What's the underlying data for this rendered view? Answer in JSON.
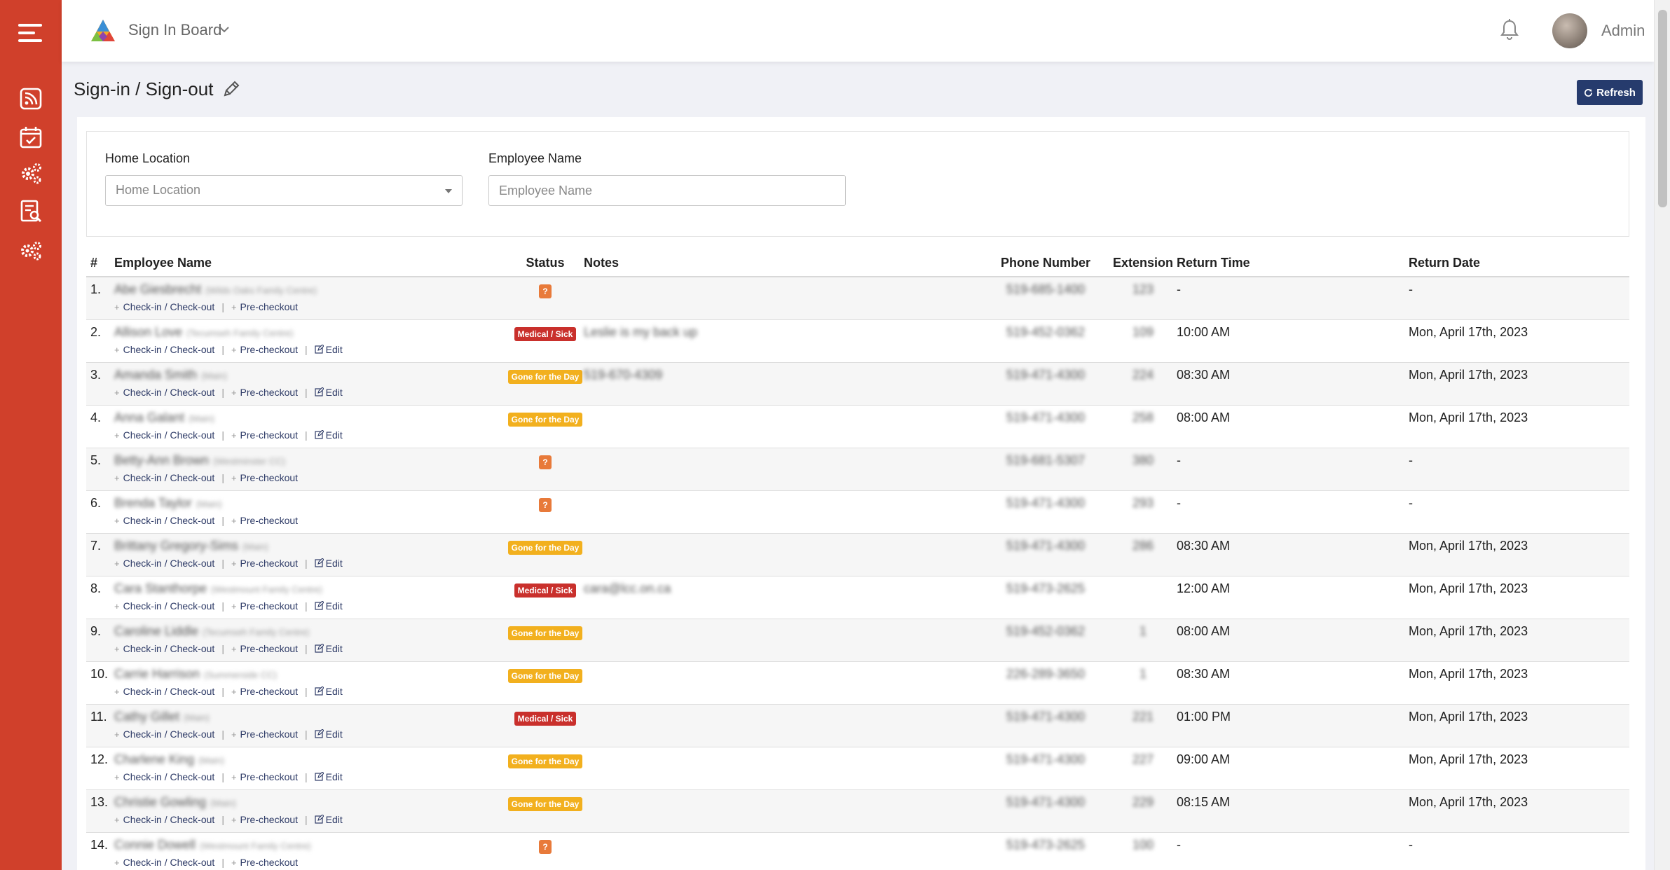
{
  "app": {
    "title": "Sign In Board",
    "user": "Admin",
    "colors": {
      "sidebar": "#d0402b",
      "primary": "#263b6d",
      "badge_sick": "#c9302c",
      "badge_gone": "#f2b01e",
      "badge_unknown": "#e87a3a"
    }
  },
  "sidebar": {
    "items": [
      {
        "icon": "rss-feed-icon"
      },
      {
        "icon": "calendar-check-icon"
      },
      {
        "icon": "gears-icon"
      },
      {
        "icon": "report-search-icon"
      },
      {
        "icon": "settings-cogs-icon"
      }
    ]
  },
  "page": {
    "title": "Sign-in / Sign-out",
    "refresh_label": "Refresh"
  },
  "filters": {
    "location_label": "Home Location",
    "location_placeholder": "Home Location",
    "name_label": "Employee Name",
    "name_placeholder": "Employee Name"
  },
  "table": {
    "headers": [
      "#",
      "Employee Name",
      "Status",
      "Notes",
      "Phone Number",
      "Extension",
      "Return Time",
      "Return Date"
    ],
    "action_labels": {
      "checkin": "Check-in / Check-out",
      "precheckout": "Pre-checkout",
      "edit": "Edit"
    },
    "rows": [
      {
        "num": "1.",
        "name": "Abe Giesbrecht",
        "loc": "(Wilds Oaks Family Centre)",
        "status": "?",
        "status_type": "q",
        "notes": "",
        "phone": "519-685-1400",
        "ext": "123",
        "return_time": "-",
        "return_date": "-",
        "edit": false
      },
      {
        "num": "2.",
        "name": "Allison Love",
        "loc": "(Tecumseh Family Centre)",
        "status": "Medical / Sick",
        "status_type": "med",
        "notes": "Leslie is my back up",
        "phone": "519-452-0362",
        "ext": "109",
        "return_time": "10:00 AM",
        "return_date": "Mon, April 17th, 2023",
        "edit": true
      },
      {
        "num": "3.",
        "name": "Amanda Smith",
        "loc": "(Main)",
        "status": "Gone for the Day",
        "status_type": "gone",
        "notes": "519-670-4309",
        "phone": "519-471-4300",
        "ext": "224",
        "return_time": "08:30 AM",
        "return_date": "Mon, April 17th, 2023",
        "edit": true
      },
      {
        "num": "4.",
        "name": "Anna Galant",
        "loc": "(Main)",
        "status": "Gone for the Day",
        "status_type": "gone",
        "notes": "",
        "phone": "519-471-4300",
        "ext": "258",
        "return_time": "08:00 AM",
        "return_date": "Mon, April 17th, 2023",
        "edit": true
      },
      {
        "num": "5.",
        "name": "Betty-Ann Brown",
        "loc": "(Westminster CC)",
        "status": "?",
        "status_type": "q",
        "notes": "",
        "phone": "519-681-5307",
        "ext": "380",
        "return_time": "-",
        "return_date": "-",
        "edit": false
      },
      {
        "num": "6.",
        "name": "Brenda Taylor",
        "loc": "(Main)",
        "status": "?",
        "status_type": "q",
        "notes": "",
        "phone": "519-471-4300",
        "ext": "293",
        "return_time": "-",
        "return_date": "-",
        "edit": false
      },
      {
        "num": "7.",
        "name": "Brittany Gregory-Sims",
        "loc": "(Main)",
        "status": "Gone for the Day",
        "status_type": "gone",
        "notes": "",
        "phone": "519-471-4300",
        "ext": "286",
        "return_time": "08:30 AM",
        "return_date": "Mon, April 17th, 2023",
        "edit": true
      },
      {
        "num": "8.",
        "name": "Cara Stanthorpe",
        "loc": "(Westmount Family Centre)",
        "status": "Medical / Sick",
        "status_type": "med",
        "notes": "cara@lcc.on.ca",
        "phone": "519-473-2625",
        "ext": "",
        "return_time": "12:00 AM",
        "return_date": "Mon, April 17th, 2023",
        "edit": true
      },
      {
        "num": "9.",
        "name": "Caroline Liddle",
        "loc": "(Tecumseh Family Centre)",
        "status": "Gone for the Day",
        "status_type": "gone",
        "notes": "",
        "phone": "519-452-0362",
        "ext": "1",
        "return_time": "08:00 AM",
        "return_date": "Mon, April 17th, 2023",
        "edit": true
      },
      {
        "num": "10.",
        "name": "Carrie Harrison",
        "loc": "(Summerside CC)",
        "status": "Gone for the Day",
        "status_type": "gone",
        "notes": "",
        "phone": "226-289-3650",
        "ext": "1",
        "return_time": "08:30 AM",
        "return_date": "Mon, April 17th, 2023",
        "edit": true
      },
      {
        "num": "11.",
        "name": "Cathy Gillet",
        "loc": "(Main)",
        "status": "Medical / Sick",
        "status_type": "med",
        "notes": "",
        "phone": "519-471-4300",
        "ext": "221",
        "return_time": "01:00 PM",
        "return_date": "Mon, April 17th, 2023",
        "edit": true
      },
      {
        "num": "12.",
        "name": "Charlene King",
        "loc": "(Main)",
        "status": "Gone for the Day",
        "status_type": "gone",
        "notes": "",
        "phone": "519-471-4300",
        "ext": "227",
        "return_time": "09:00 AM",
        "return_date": "Mon, April 17th, 2023",
        "edit": true
      },
      {
        "num": "13.",
        "name": "Christie Gowling",
        "loc": "(Main)",
        "status": "Gone for the Day",
        "status_type": "gone",
        "notes": "",
        "phone": "519-471-4300",
        "ext": "229",
        "return_time": "08:15 AM",
        "return_date": "Mon, April 17th, 2023",
        "edit": true
      },
      {
        "num": "14.",
        "name": "Connie Dowell",
        "loc": "(Westmount Family Centre)",
        "status": "?",
        "status_type": "q",
        "notes": "",
        "phone": "519-473-2625",
        "ext": "100",
        "return_time": "-",
        "return_date": "-",
        "edit": false
      }
    ]
  }
}
